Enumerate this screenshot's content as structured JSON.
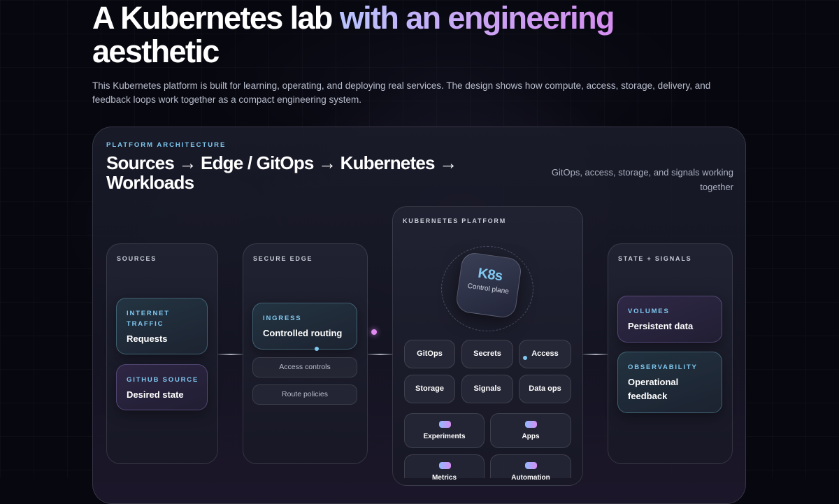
{
  "hero": {
    "title_plain": "A Kubernetes lab ",
    "title_accent": "with an engineering",
    "title_end": "aesthetic",
    "description": "This Kubernetes platform is built for learning, operating, and deploying real services. The design shows how compute, access, storage, delivery, and feedback loops work together as a compact engineering system."
  },
  "architecture": {
    "eyebrow": "PLATFORM ARCHITECTURE",
    "title": "Sources → Edge / GitOps → Kubernetes → Workloads",
    "note": "GitOps, access, storage, and signals working together",
    "sources": {
      "label": "SOURCES",
      "cards": [
        {
          "eyebrow": "INTERNET TRAFFIC",
          "text": "Requests"
        },
        {
          "eyebrow": "GITHUB SOURCE",
          "text": "Desired state"
        }
      ]
    },
    "edge": {
      "label": "SECURE EDGE",
      "card": {
        "eyebrow": "INGRESS",
        "text": "Controlled routing"
      },
      "pills": [
        "Access controls",
        "Route policies"
      ]
    },
    "platform": {
      "label": "KUBERNETES PLATFORM",
      "badge_title": "K8s",
      "badge_subtitle": "Control plane",
      "chips": [
        "GitOps",
        "Secrets",
        "Access",
        "Storage",
        "Signals",
        "Data ops"
      ],
      "workloads": [
        "Experiments",
        "Apps",
        "Metrics",
        "Automation"
      ]
    },
    "state": {
      "label": "STATE + SIGNALS",
      "cards": [
        {
          "eyebrow": "VOLUMES",
          "text": "Persistent data"
        },
        {
          "eyebrow": "OBSERVABILITY",
          "text": "Operational feedback"
        }
      ]
    }
  },
  "colors": {
    "background": "#07070f",
    "accent_blue": "#7fc8f0",
    "accent_purple": "#d58ef0",
    "flow_dot": "#e08af2"
  }
}
